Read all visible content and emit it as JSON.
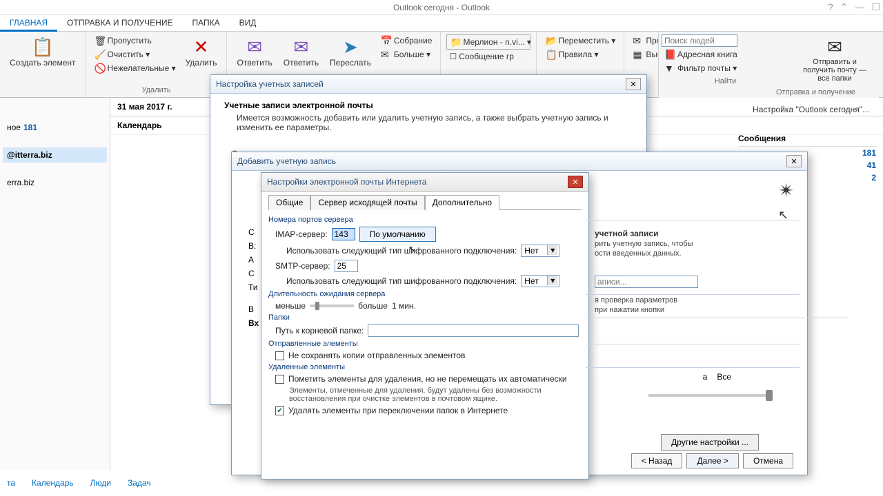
{
  "titlebar": {
    "title": "Outlook сегодня - Outlook"
  },
  "ribbon_tabs": {
    "home": "ГЛАВНАЯ",
    "sendrecv": "ОТПРАВКА И ПОЛУЧЕНИЕ",
    "folder": "ПАПКА",
    "view": "ВИД"
  },
  "ribbon": {
    "new_item": "Создать элемент",
    "skip": "Пропустить",
    "cleanup": "Очистить ▾",
    "junk": "Нежелательные ▾",
    "delete": "Удалить",
    "delete_group": "Удалить",
    "reply": "Ответить",
    "reply_all": "Ответить",
    "forward": "Переслать",
    "meeting": "Собрание",
    "more": "Больше ▾",
    "move": "Переместить ▾",
    "rules": "Правила ▾",
    "read": "Прочитано?",
    "categorize": "Выбрать категорию ▾",
    "filter": "Фильтр почты ▾",
    "find_people": "Поиск людей",
    "address_book": "Адресная книга",
    "find_group": "Найти",
    "sendrecv_all": "Отправить и получить почту — все папки",
    "sendrecv_group": "Отправка и получение",
    "folder_dropdown": "Мерлион - n.vi...",
    "msg_draft": "Сообщение гр",
    "inbox_label": "ное",
    "inbox_count": "181"
  },
  "date": "31 мая 2017 г.",
  "calendar_label": "Календарь",
  "account1": "@itterra.biz",
  "account2": "erra.biz",
  "outlooktoday": "Настройка \"Outlook сегодня\"...",
  "msgs": {
    "header": "Сообщения",
    "v1": "181",
    "v2": "41",
    "v3": "2"
  },
  "dlg1": {
    "title": "Настройка учетных записей",
    "heading": "Учетные записи электронной почты",
    "desc": "Имеется возможность добавить или удалить учетную запись, а также выбрать учетную запись и изменить ее параметры.",
    "tab": "Эл"
  },
  "dlg2": {
    "title": "Добавить учетную запись",
    "right_heading": "учетной записи",
    "right_desc1": "рить учетную запись, чтобы",
    "right_desc2": "ости введенных данных.",
    "right_placeholder": "аписи...",
    "right_desc3": "я проверка параметров",
    "right_desc4": "при нажатии кнопки",
    "filter_a": "а",
    "filter_all": "Все",
    "other_settings": "Другие настройки ...",
    "back": "< Назад",
    "next": "Далее >",
    "cancel": "Отмена",
    "left_s": "С",
    "left_v1": "В:",
    "left_a": "А",
    "left_c": "С",
    "left_t": "Ти",
    "left_v2": "В",
    "left_vx": "Вх"
  },
  "dlg3": {
    "title": "Настройки электронной почты Интернета",
    "tab_general": "Общие",
    "tab_outgoing": "Сервер исходящей почты",
    "tab_advanced": "Дополнительно",
    "ports_label": "Номера портов сервера",
    "imap_label": "IMAP-сервер:",
    "imap_value": "143",
    "default_btn": "По умолчанию",
    "enc_label": "Использовать следующий тип шифрованного подключения:",
    "enc_value": "Нет",
    "smtp_label": "SMTP-сервер:",
    "smtp_value": "25",
    "timeout_label": "Длительность ожидания сервера",
    "less": "меньше",
    "more": "больше",
    "timeout_val": "1 мин.",
    "folders_label": "Папки",
    "rootpath_label": "Путь к корневой папке:",
    "sent_label": "Отправленные элементы",
    "sent_check": "Не сохранять копии отправленных элементов",
    "deleted_label": "Удаленные элементы",
    "del_check1": "Пометить элементы для удаления, но не перемещать их автоматически",
    "del_desc": "Элементы, отмеченные для удаления, будут удалены без возможности восстановления при очистке элементов в почтовом ящике.",
    "del_check2": "Удалять элементы при переключении папок в Интернете"
  },
  "bottomnav": {
    "mail": "та",
    "calendar": "Календарь",
    "people": "Люди",
    "tasks": "Задач"
  }
}
